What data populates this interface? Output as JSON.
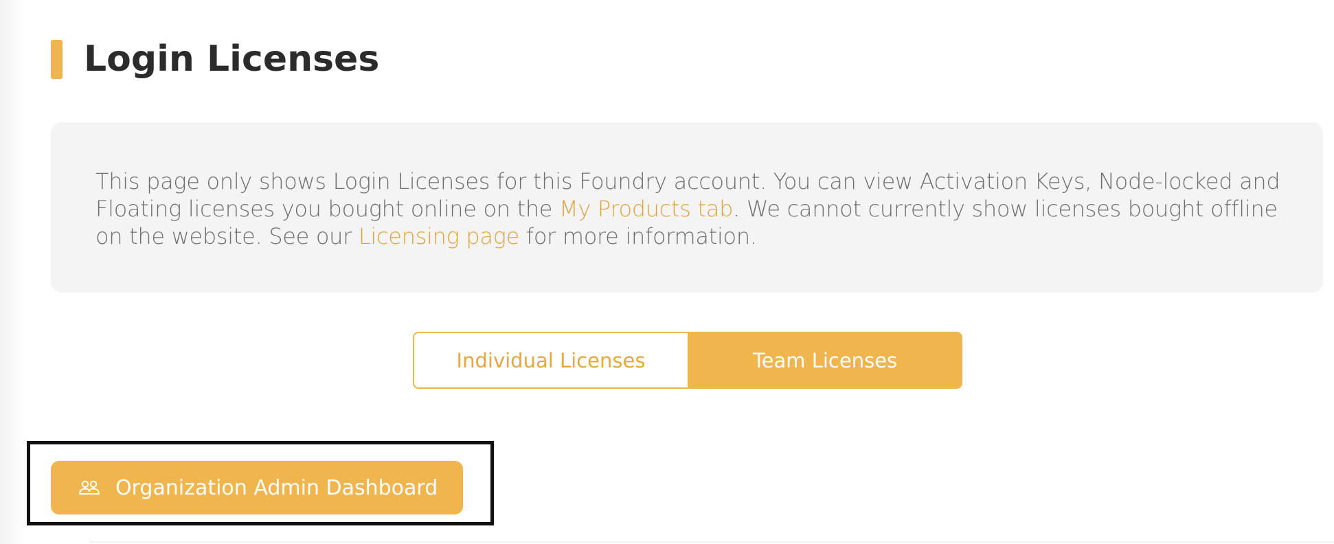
{
  "page": {
    "title": "Login Licenses",
    "accent_color": "#f0b64d"
  },
  "info": {
    "text_before_link1": "This page only shows Login Licenses for this Foundry account. You can view Activation Keys, Node-locked and Floating licenses you bought online on the ",
    "link1": "My Products tab",
    "text_between": ". We cannot currently show licenses bought offline on the website. See our ",
    "link2": "Licensing page",
    "text_after": " for more information."
  },
  "license_toggle": {
    "options": [
      {
        "label": "Individual Licenses",
        "selected": false
      },
      {
        "label": "Team Licenses",
        "selected": true
      }
    ]
  },
  "admin_button": {
    "label": "Organization Admin Dashboard",
    "icon": "users-icon"
  }
}
